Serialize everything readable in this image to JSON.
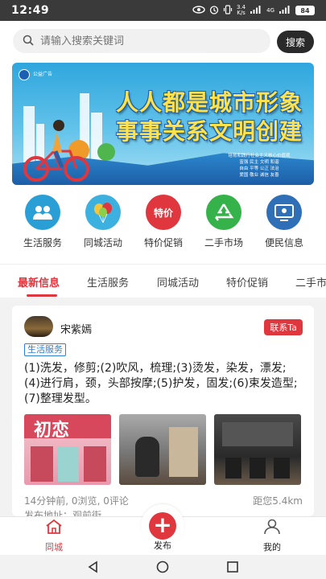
{
  "status_bar": {
    "time": "12:49",
    "network_speed": "3.4\nK/s",
    "signal_label": "4G",
    "battery": "84"
  },
  "search": {
    "placeholder": "请输入搜索关键词",
    "button_label": "搜索"
  },
  "banner": {
    "logo_text": "公益广告",
    "line1": "人人都是城市形象",
    "line2": "事事关系文明创建",
    "footer_title": "培育和践行社会主义核心价值观",
    "footer_values": [
      "富强 民主 文明 和谐",
      "自由 平等 公正 法治",
      "爱国 敬业 诚信 友善"
    ]
  },
  "categories": [
    {
      "label": "生活服务",
      "icon": "life-service-icon",
      "color": "#2a9fd6"
    },
    {
      "label": "同城活动",
      "icon": "balloon-icon",
      "color": "#3cb1e0"
    },
    {
      "label": "特价促销",
      "icon": "sale-tag-icon",
      "color": "#e0373e",
      "icon_text": "特价"
    },
    {
      "label": "二手市场",
      "icon": "recycle-icon",
      "color": "#36b24a"
    },
    {
      "label": "便民信息",
      "icon": "info-board-icon",
      "color": "#2e6fb8"
    }
  ],
  "tabs": [
    "最新信息",
    "生活服务",
    "同城活动",
    "特价促销",
    "二手市"
  ],
  "active_tab": "最新信息",
  "post": {
    "username": "宋紫嫣",
    "contact_label": "联系Ta",
    "category_tag": "生活服务",
    "body": "(1)洗发，修剪;(2)吹风，梳理;(3)烫发，染发，漂发;(4)进行肩，颈，头部按摩;(5)护发，固发;(6)束发造型;(7)整理发型。",
    "photo_sign_text": "初恋",
    "time_ago": "14分钟前",
    "views": "0浏览",
    "comments": "0评论",
    "distance": "距您5.4km",
    "address_label": "发布地址：观前街"
  },
  "bottom_nav": {
    "home_label": "同城",
    "publish_label": "发布",
    "profile_label": "我的",
    "active_color": "#e0373e"
  }
}
